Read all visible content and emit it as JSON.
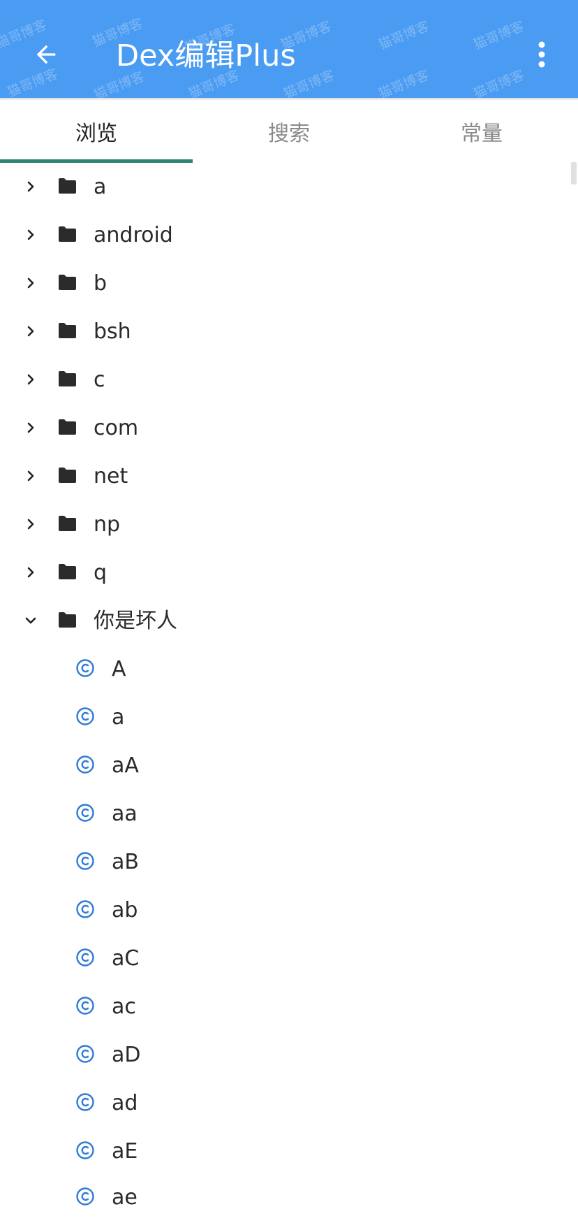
{
  "appbar": {
    "title": "Dex编辑Plus",
    "back_icon": "arrow-left-icon",
    "more_icon": "more-vert-icon",
    "color": "#4a9bf2",
    "watermark_text": "猫哥博客"
  },
  "tabs": [
    {
      "label": "浏览",
      "active": true
    },
    {
      "label": "搜索",
      "active": false
    },
    {
      "label": "常量",
      "active": false
    }
  ],
  "accent_color": "#2f8574",
  "tree": {
    "packages": [
      {
        "label": "a",
        "expanded": false
      },
      {
        "label": "android",
        "expanded": false
      },
      {
        "label": "b",
        "expanded": false
      },
      {
        "label": "bsh",
        "expanded": false
      },
      {
        "label": "c",
        "expanded": false
      },
      {
        "label": "com",
        "expanded": false
      },
      {
        "label": "net",
        "expanded": false
      },
      {
        "label": "np",
        "expanded": false
      },
      {
        "label": "q",
        "expanded": false
      },
      {
        "label": "你是坏人",
        "expanded": true
      }
    ],
    "classes": [
      {
        "label": "A"
      },
      {
        "label": "a"
      },
      {
        "label": "aA"
      },
      {
        "label": "aa"
      },
      {
        "label": "aB"
      },
      {
        "label": "ab"
      },
      {
        "label": "aC"
      },
      {
        "label": "ac"
      },
      {
        "label": "aD"
      },
      {
        "label": "ad"
      },
      {
        "label": "aE"
      },
      {
        "label": "ae"
      }
    ],
    "class_icon_color": "#2f7bd6"
  }
}
